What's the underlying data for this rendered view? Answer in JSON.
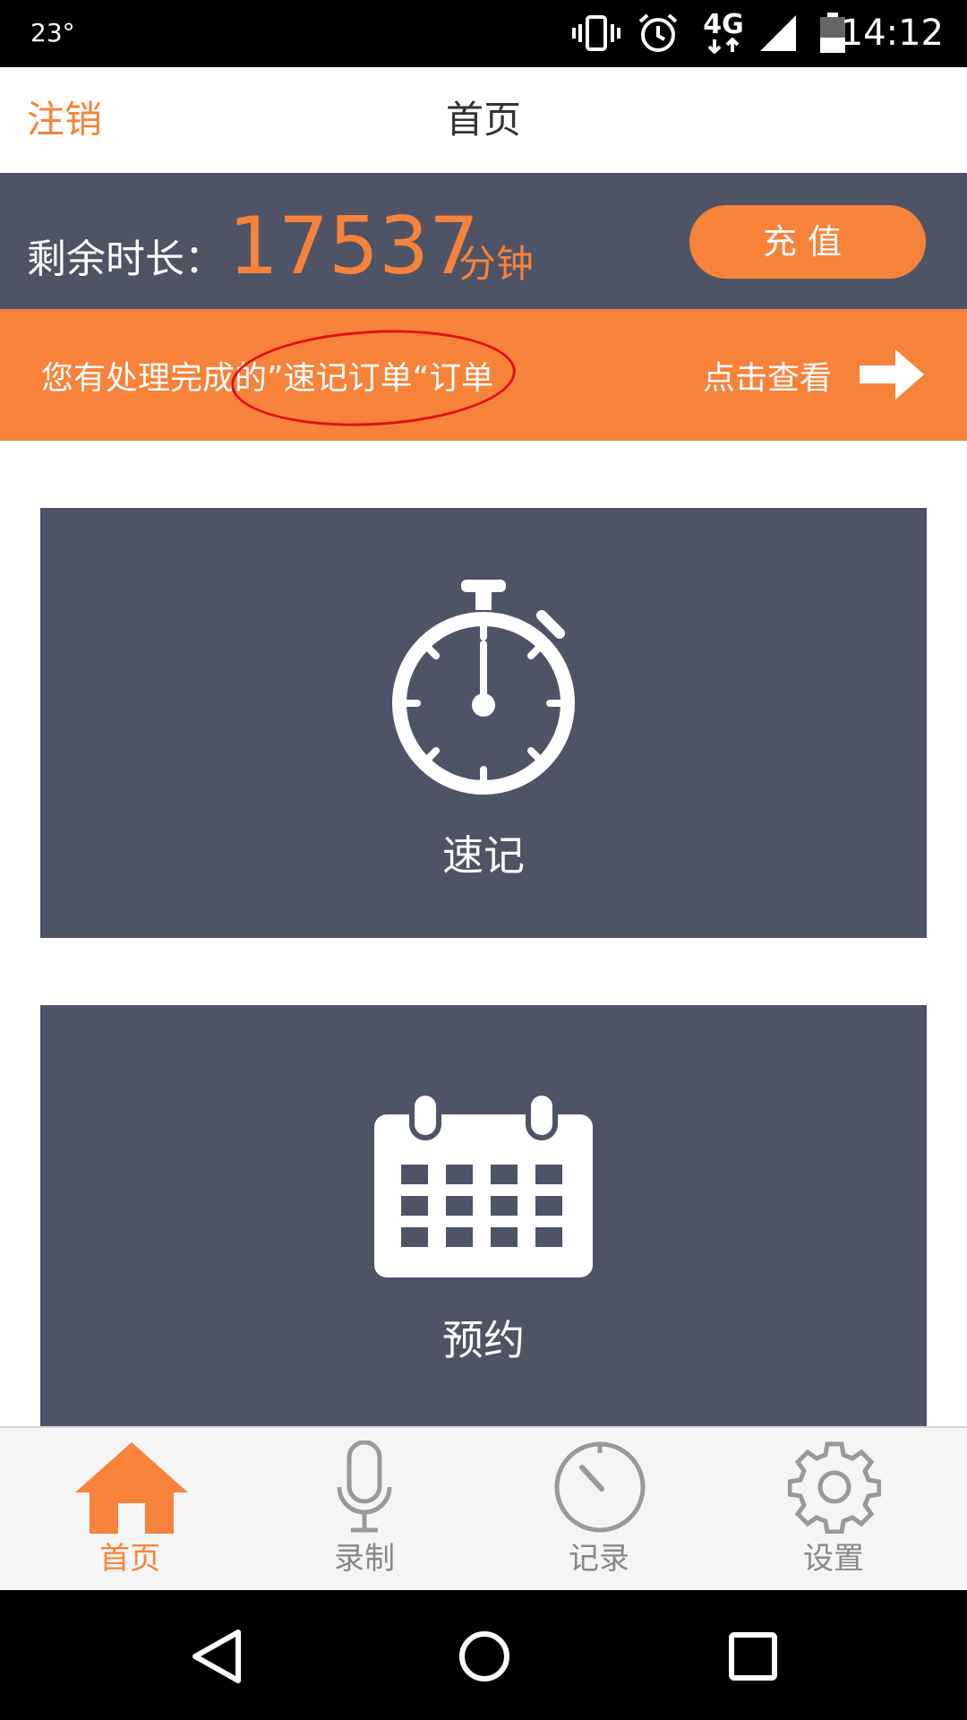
{
  "status_bar": {
    "temperature": "23°",
    "network": "4G",
    "time": "14:12",
    "icons": [
      "vibrate-icon",
      "alarm-icon",
      "network-4g-icon",
      "signal-icon",
      "battery-icon"
    ]
  },
  "header": {
    "logout_label": "注销",
    "title": "首页"
  },
  "balance": {
    "label": "剩余时长：",
    "value": "17537",
    "unit": "分钟",
    "recharge_label": "充值"
  },
  "notice": {
    "text": "您有处理完成的”速记订单“订单",
    "link_label": "点击查看"
  },
  "cards": [
    {
      "label": "速记",
      "icon": "stopwatch-icon"
    },
    {
      "label": "预约",
      "icon": "calendar-icon"
    }
  ],
  "tabs": [
    {
      "label": "首页",
      "icon": "home-icon",
      "active": true
    },
    {
      "label": "录制",
      "icon": "microphone-icon",
      "active": false
    },
    {
      "label": "记录",
      "icon": "gauge-icon",
      "active": false
    },
    {
      "label": "设置",
      "icon": "gear-icon",
      "active": false
    }
  ],
  "nav_buttons": [
    "back-icon",
    "home-circle-icon",
    "recents-icon"
  ],
  "colors": {
    "accent": "#f7833a",
    "panel": "#4e5466",
    "annotation": "#e01010"
  }
}
